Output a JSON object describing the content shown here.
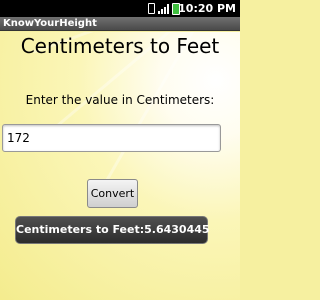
{
  "status_bar": {
    "time": "10:20 PM",
    "icons": [
      "vibrate-icon",
      "signal-icon",
      "battery-icon"
    ],
    "battery_color": "#3fbf3f"
  },
  "app": {
    "title": "KnowYourHeight"
  },
  "main": {
    "heading": "Centimeters to Feet",
    "prompt": "Enter the value in Centimeters:",
    "input_value": "172",
    "convert_label": "Convert",
    "result_text": "Centimeters to Feet:5.6430445"
  }
}
